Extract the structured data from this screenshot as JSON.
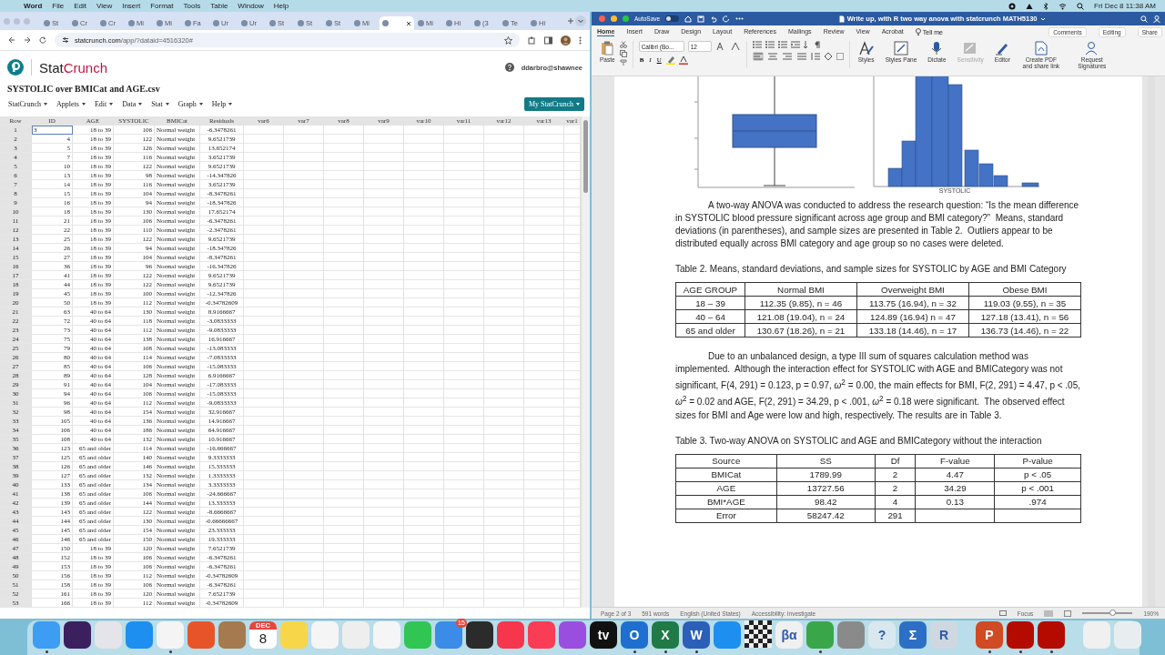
{
  "menubar": {
    "app": "Word",
    "items": [
      "File",
      "Edit",
      "View",
      "Insert",
      "Format",
      "Tools",
      "Table",
      "Window",
      "Help"
    ],
    "clock": "Fri Dec 8  11:38 AM"
  },
  "browser": {
    "tabs": [
      {
        "label": "St",
        "selected": false
      },
      {
        "label": "Cr",
        "selected": false
      },
      {
        "label": "Cr",
        "selected": false
      },
      {
        "label": "Mi",
        "selected": false
      },
      {
        "label": "Mi",
        "selected": false
      },
      {
        "label": "Fa",
        "selected": false
      },
      {
        "label": "Ur",
        "selected": false
      },
      {
        "label": "Ur",
        "selected": false
      },
      {
        "label": "St",
        "selected": false
      },
      {
        "label": "St",
        "selected": false
      },
      {
        "label": "St",
        "selected": false
      },
      {
        "label": "Mi",
        "selected": false
      },
      {
        "selected": true
      },
      {
        "label": "Mi",
        "selected": false
      },
      {
        "label": "Hi",
        "selected": false
      },
      {
        "label": "(3",
        "selected": false
      },
      {
        "label": "Te",
        "selected": false
      },
      {
        "label": "Hi",
        "selected": false
      }
    ],
    "url_host": "statcrunch.com",
    "url_path": "/app/?dataid=4516320#"
  },
  "statcrunch": {
    "brand": [
      "Stat",
      "Crunch"
    ],
    "user": "ddarbro@shawnee",
    "dataset_title": "SYSTOLIC over BMICat and AGE.csv",
    "menus": [
      "StatCrunch",
      "Applets",
      "Edit",
      "Data",
      "Stat",
      "Graph",
      "Help"
    ],
    "my_button": "My StatCrunch",
    "grid": {
      "columns": [
        "Row",
        "ID",
        "AGE",
        "SYSTOLIC",
        "BMICat",
        "Residuals",
        "var6",
        "var7",
        "var8",
        "var9",
        "var10",
        "var11",
        "var12",
        "var13",
        "var1"
      ],
      "rows": [
        {
          "cells": [
            "1",
            "3",
            "18 to 39",
            "106",
            "Normal weight",
            "-6.3478261"
          ],
          "selected": true
        },
        {
          "cells": [
            "2",
            "4",
            "18 to 39",
            "122",
            "Normal weight",
            "9.6521739"
          ],
          "selected": false
        },
        {
          "cells": [
            "3",
            "5",
            "18 to 39",
            "126",
            "Normal weight",
            "13.652174"
          ],
          "selected": false
        },
        {
          "cells": [
            "4",
            "7",
            "18 to 39",
            "116",
            "Normal weight",
            "3.6521739"
          ],
          "selected": false
        },
        {
          "cells": [
            "5",
            "10",
            "18 to 39",
            "122",
            "Normal weight",
            "9.6521739"
          ],
          "selected": false
        },
        {
          "cells": [
            "6",
            "13",
            "18 to 39",
            "98",
            "Normal weight",
            "-14.347826"
          ],
          "selected": false
        },
        {
          "cells": [
            "7",
            "14",
            "18 to 39",
            "116",
            "Normal weight",
            "3.6521739"
          ],
          "selected": false
        },
        {
          "cells": [
            "8",
            "15",
            "18 to 39",
            "104",
            "Normal weight",
            "-8.3478261"
          ],
          "selected": false
        },
        {
          "cells": [
            "9",
            "16",
            "18 to 39",
            "94",
            "Normal weight",
            "-18.347826"
          ],
          "selected": false
        },
        {
          "cells": [
            "10",
            "18",
            "18 to 39",
            "130",
            "Normal weight",
            "17.652174"
          ],
          "selected": false
        },
        {
          "cells": [
            "11",
            "21",
            "18 to 39",
            "106",
            "Normal weight",
            "-6.3478261"
          ],
          "selected": false
        },
        {
          "cells": [
            "12",
            "22",
            "18 to 39",
            "110",
            "Normal weight",
            "-2.3478261"
          ],
          "selected": false
        },
        {
          "cells": [
            "13",
            "25",
            "18 to 39",
            "122",
            "Normal weight",
            "9.6521739"
          ],
          "selected": false
        },
        {
          "cells": [
            "14",
            "26",
            "18 to 39",
            "94",
            "Normal weight",
            "-18.347826"
          ],
          "selected": false
        },
        {
          "cells": [
            "15",
            "27",
            "18 to 39",
            "104",
            "Normal weight",
            "-8.3478261"
          ],
          "selected": false
        },
        {
          "cells": [
            "16",
            "36",
            "18 to 39",
            "96",
            "Normal weight",
            "-16.347826"
          ],
          "selected": false
        },
        {
          "cells": [
            "17",
            "41",
            "18 to 39",
            "122",
            "Normal weight",
            "9.6521739"
          ],
          "selected": false
        },
        {
          "cells": [
            "18",
            "44",
            "18 to 39",
            "122",
            "Normal weight",
            "9.6521739"
          ],
          "selected": false
        },
        {
          "cells": [
            "19",
            "45",
            "18 to 39",
            "100",
            "Normal weight",
            "-12.347826"
          ],
          "selected": false
        },
        {
          "cells": [
            "20",
            "50",
            "18 to 39",
            "112",
            "Normal weight",
            "-0.34782609"
          ],
          "selected": false
        },
        {
          "cells": [
            "21",
            "63",
            "40 to 64",
            "130",
            "Normal weight",
            "8.9166667"
          ],
          "selected": false
        },
        {
          "cells": [
            "22",
            "72",
            "40 to 64",
            "118",
            "Normal weight",
            "-3.0833333"
          ],
          "selected": false
        },
        {
          "cells": [
            "23",
            "73",
            "40 to 64",
            "112",
            "Normal weight",
            "-9.0833333"
          ],
          "selected": false
        },
        {
          "cells": [
            "24",
            "75",
            "40 to 64",
            "138",
            "Normal weight",
            "16.916667"
          ],
          "selected": false
        },
        {
          "cells": [
            "25",
            "79",
            "40 to 64",
            "108",
            "Normal weight",
            "-13.083333"
          ],
          "selected": false
        },
        {
          "cells": [
            "26",
            "80",
            "40 to 64",
            "114",
            "Normal weight",
            "-7.0833333"
          ],
          "selected": false
        },
        {
          "cells": [
            "27",
            "85",
            "40 to 64",
            "106",
            "Normal weight",
            "-15.083333"
          ],
          "selected": false
        },
        {
          "cells": [
            "28",
            "89",
            "40 to 64",
            "128",
            "Normal weight",
            "6.9166667"
          ],
          "selected": false
        },
        {
          "cells": [
            "29",
            "91",
            "40 to 64",
            "104",
            "Normal weight",
            "-17.083333"
          ],
          "selected": false
        },
        {
          "cells": [
            "30",
            "94",
            "40 to 64",
            "106",
            "Normal weight",
            "-15.083333"
          ],
          "selected": false
        },
        {
          "cells": [
            "31",
            "96",
            "40 to 64",
            "112",
            "Normal weight",
            "-9.0833333"
          ],
          "selected": false
        },
        {
          "cells": [
            "32",
            "98",
            "40 to 64",
            "154",
            "Normal weight",
            "32.916667"
          ],
          "selected": false
        },
        {
          "cells": [
            "33",
            "105",
            "40 to 64",
            "136",
            "Normal weight",
            "14.916667"
          ],
          "selected": false
        },
        {
          "cells": [
            "34",
            "106",
            "40 to 64",
            "186",
            "Normal weight",
            "64.916667"
          ],
          "selected": false
        },
        {
          "cells": [
            "35",
            "108",
            "40 to 64",
            "132",
            "Normal weight",
            "10.916667"
          ],
          "selected": false
        },
        {
          "cells": [
            "36",
            "123",
            "65 and older",
            "114",
            "Normal weight",
            "-16.666667"
          ],
          "selected": false
        },
        {
          "cells": [
            "37",
            "125",
            "65 and older",
            "140",
            "Normal weight",
            "9.3333333"
          ],
          "selected": false
        },
        {
          "cells": [
            "38",
            "126",
            "65 and older",
            "146",
            "Normal weight",
            "15.333333"
          ],
          "selected": false
        },
        {
          "cells": [
            "39",
            "127",
            "65 and older",
            "132",
            "Normal weight",
            "1.3333333"
          ],
          "selected": false
        },
        {
          "cells": [
            "40",
            "133",
            "65 and older",
            "134",
            "Normal weight",
            "3.3333333"
          ],
          "selected": false
        },
        {
          "cells": [
            "41",
            "138",
            "65 and older",
            "106",
            "Normal weight",
            "-24.666667"
          ],
          "selected": false
        },
        {
          "cells": [
            "42",
            "139",
            "65 and older",
            "144",
            "Normal weight",
            "13.333333"
          ],
          "selected": false
        },
        {
          "cells": [
            "43",
            "143",
            "65 and older",
            "122",
            "Normal weight",
            "-8.6666667"
          ],
          "selected": false
        },
        {
          "cells": [
            "44",
            "144",
            "65 and older",
            "130",
            "Normal weight",
            "-0.66666667"
          ],
          "selected": false
        },
        {
          "cells": [
            "45",
            "145",
            "65 and older",
            "154",
            "Normal weight",
            "23.333333"
          ],
          "selected": false
        },
        {
          "cells": [
            "46",
            "146",
            "65 and older",
            "150",
            "Normal weight",
            "19.333333"
          ],
          "selected": false
        },
        {
          "cells": [
            "47",
            "150",
            "18 to 39",
            "120",
            "Normal weight",
            "7.6521739"
          ],
          "selected": false
        },
        {
          "cells": [
            "48",
            "152",
            "18 to 39",
            "106",
            "Normal weight",
            "-6.3478261"
          ],
          "selected": false
        },
        {
          "cells": [
            "49",
            "153",
            "18 to 39",
            "106",
            "Normal weight",
            "-6.3478261"
          ],
          "selected": false
        },
        {
          "cells": [
            "50",
            "156",
            "18 to 39",
            "112",
            "Normal weight",
            "-0.34782609"
          ],
          "selected": false
        },
        {
          "cells": [
            "51",
            "158",
            "18 to 39",
            "106",
            "Normal weight",
            "-6.3478261"
          ],
          "selected": false
        },
        {
          "cells": [
            "52",
            "161",
            "18 to 39",
            "120",
            "Normal weight",
            "7.6521739"
          ],
          "selected": false
        },
        {
          "cells": [
            "53",
            "166",
            "18 to 39",
            "112",
            "Normal weight",
            "-0.34782609"
          ],
          "selected": false
        }
      ]
    }
  },
  "word": {
    "autosave": "AutoSave",
    "autosave_on": false,
    "title": "Write up, with R two way anova with statcrunch MATH5130",
    "tabs": [
      {
        "label": "Home",
        "selected": true
      },
      {
        "label": "Insert",
        "selected": false
      },
      {
        "label": "Draw",
        "selected": false
      },
      {
        "label": "Design",
        "selected": false
      },
      {
        "label": "Layout",
        "selected": false
      },
      {
        "label": "References",
        "selected": false
      },
      {
        "label": "Mailings",
        "selected": false
      },
      {
        "label": "Review",
        "selected": false
      },
      {
        "label": "View",
        "selected": false
      },
      {
        "label": "Acrobat",
        "selected": false
      }
    ],
    "tell_me": "Tell me",
    "right_buttons": [
      "Comments",
      "Editing",
      "Share"
    ],
    "paste": "Paste",
    "font_name": "Calibri (Bo...",
    "font_size": "12",
    "format_buttons": [
      "B",
      "I",
      "U"
    ],
    "align": [
      {
        "selected": true
      },
      {
        "selected": false
      },
      {
        "selected": false
      },
      {
        "selected": false
      }
    ],
    "big_buttons": [
      {
        "kind": "styles",
        "label": "Styles",
        "disabled": false
      },
      {
        "kind": "pane",
        "label": "Styles Pane",
        "disabled": false
      },
      {
        "kind": "dictate",
        "label": "Dictate",
        "disabled": false
      },
      {
        "kind": "sensitivity",
        "label": "Sensitivity",
        "disabled": true
      },
      {
        "kind": "editor",
        "label": "Editor",
        "disabled": false
      },
      {
        "kind": "pdf",
        "label": "Create PDF and share link",
        "disabled": false
      },
      {
        "kind": "signature",
        "label": "Request Signatures",
        "disabled": false
      }
    ],
    "histogram_axis_label": "SYSTOLIC",
    "paragraph_1": "A two-way ANOVA was conducted to address the research question: “Is the mean difference in SYSTOLIC blood pressure significant across age group and BMI category?”  Means, standard deviations (in parentheses), and sample sizes are presented in Table 2.  Outliers appear to be distributed equally across BMI category and age group so no cases were deleted.",
    "caption_2": "Table 2. Means, standard deviations, and sample sizes for SYSTOLIC by AGE and BMI Category",
    "table_2": {
      "columns": [
        "AGE GROUP",
        "Normal BMI",
        "Overweight BMI",
        "Obese BMI"
      ],
      "rows": [
        [
          "18 – 39",
          "112.35 (9.85), n = 46",
          "113.75 (16.94), n = 32",
          "119.03 (9.55), n = 35"
        ],
        [
          "40 – 64",
          "121.08 (19.04), n = 24",
          "124.89 (16.94) n = 47",
          "127.18 (13.41), n = 56"
        ],
        [
          "65 and older",
          "130.67 (18.26), n = 21",
          "133.18 (14.46), n = 17",
          "136.73 (14.46), n = 22"
        ]
      ]
    },
    "paragraph_2": "Due to an unbalanced design, a type III sum of squares calculation method was implemented.  Although the interaction effect for SYSTOLIC with AGE and BMICategory was not significant, F(4, 291) = 0.123, p = 0.97, *ω*$^{2}$ = 0.00, the main effects for BMI, F(2, 291) = 4.47, p < .05, *ω*$^{2}$ = 0.02 and AGE, F(2, 291) = 34.29, p < .001, *ω*$^{2}$ = 0.18 were significant.  The observed effect sizes for BMI and Age were low and high, respectively. The results are in Table 3.",
    "caption_3": "Table 3. Two-way ANOVA on SYSTOLIC and AGE and BMICategory without the interaction",
    "table_3": {
      "columns": [
        "Source",
        "SS",
        "Df",
        "F-value",
        "P-value"
      ],
      "rows": [
        [
          "BMICat",
          "1789.99",
          "2",
          "4.47",
          "p < .05"
        ],
        [
          "AGE",
          "13727.56",
          "2",
          "34.29",
          "p < .001"
        ],
        [
          "BMI*AGE",
          "98.42",
          "4",
          "0.13",
          ".974"
        ],
        [
          "Error",
          "58247.42",
          "291"
        ]
      ]
    },
    "status": [
      "Page 2 of 3",
      "591 words",
      "English (United States)",
      "Accessibility: Investigate"
    ],
    "focus": "Focus",
    "zoom": "190%",
    "zoom_slider": {
      "level": 0.6
    }
  },
  "dock": [
    {
      "kind": "app",
      "color": "#3d9df3",
      "running": true
    },
    {
      "kind": "app",
      "color": "#3b1f5e",
      "running": false
    },
    {
      "kind": "app",
      "color": "#e4e4ea",
      "running": false
    },
    {
      "kind": "app",
      "color": "#1d8ff0",
      "running": false
    },
    {
      "kind": "app",
      "color": "#f4f4f4",
      "running": true
    },
    {
      "kind": "app",
      "color": "#e8542a",
      "running": false
    },
    {
      "kind": "app",
      "color": "#a47a4e",
      "running": false
    },
    {
      "kind": "calendar",
      "month": "DEC",
      "day": "8",
      "running": false
    },
    {
      "kind": "app",
      "color": "#f7d64a",
      "running": false
    },
    {
      "kind": "app",
      "color": "#f5f5f5",
      "running": false
    },
    {
      "kind": "app",
      "color": "#eeeeee",
      "running": false
    },
    {
      "kind": "app",
      "color": "#f5f5f5",
      "running": false
    },
    {
      "kind": "app",
      "color": "#31c553",
      "running": false
    },
    {
      "kind": "app",
      "color": "#3b8be8",
      "badge": "15",
      "running": false
    },
    {
      "kind": "app",
      "color": "#2b2b2b",
      "running": false
    },
    {
      "kind": "app",
      "color": "#f5364d",
      "running": false
    },
    {
      "kind": "app",
      "color": "#fb3c56",
      "running": false
    },
    {
      "kind": "app",
      "color": "#9a4ee0",
      "running": false
    },
    {
      "kind": "app",
      "color": "#111111",
      "glyph": "tv",
      "running": false
    },
    {
      "kind": "app",
      "color": "#1f6fd0",
      "glyph": "O",
      "running": true
    },
    {
      "kind": "app",
      "color": "#1f7a45",
      "glyph": "X",
      "running": true
    },
    {
      "kind": "app",
      "color": "#2b5fb8",
      "glyph": "W",
      "running": true
    },
    {
      "kind": "app",
      "color": "#1d8ff0",
      "running": false
    },
    {
      "kind": "chess",
      "running": false
    },
    {
      "kind": "app",
      "color": "#f0f0f0",
      "glyph": "βα",
      "running": false
    },
    {
      "kind": "app",
      "color": "#3aa64a",
      "running": true
    },
    {
      "kind": "app",
      "color": "#8a8a8a",
      "running": false
    },
    {
      "kind": "app",
      "color": "#d9e8ee",
      "glyph": "?",
      "running": false
    },
    {
      "kind": "app",
      "color": "#2d6fc4",
      "glyph": "Σ",
      "running": false
    },
    {
      "kind": "app",
      "color": "#cfd8e0",
      "glyph": "R",
      "running": false
    },
    {
      "kind": "divider"
    },
    {
      "kind": "app",
      "color": "#d04a24",
      "glyph": "P",
      "running": true
    },
    {
      "kind": "app",
      "color": "#b30b00",
      "running": true
    },
    {
      "kind": "app",
      "color": "#b30b00",
      "running": true
    },
    {
      "kind": "divider"
    },
    {
      "kind": "app",
      "color": "#f0f0f0",
      "running": false
    },
    {
      "kind": "app",
      "color": "#e8eef0",
      "running": false
    }
  ]
}
